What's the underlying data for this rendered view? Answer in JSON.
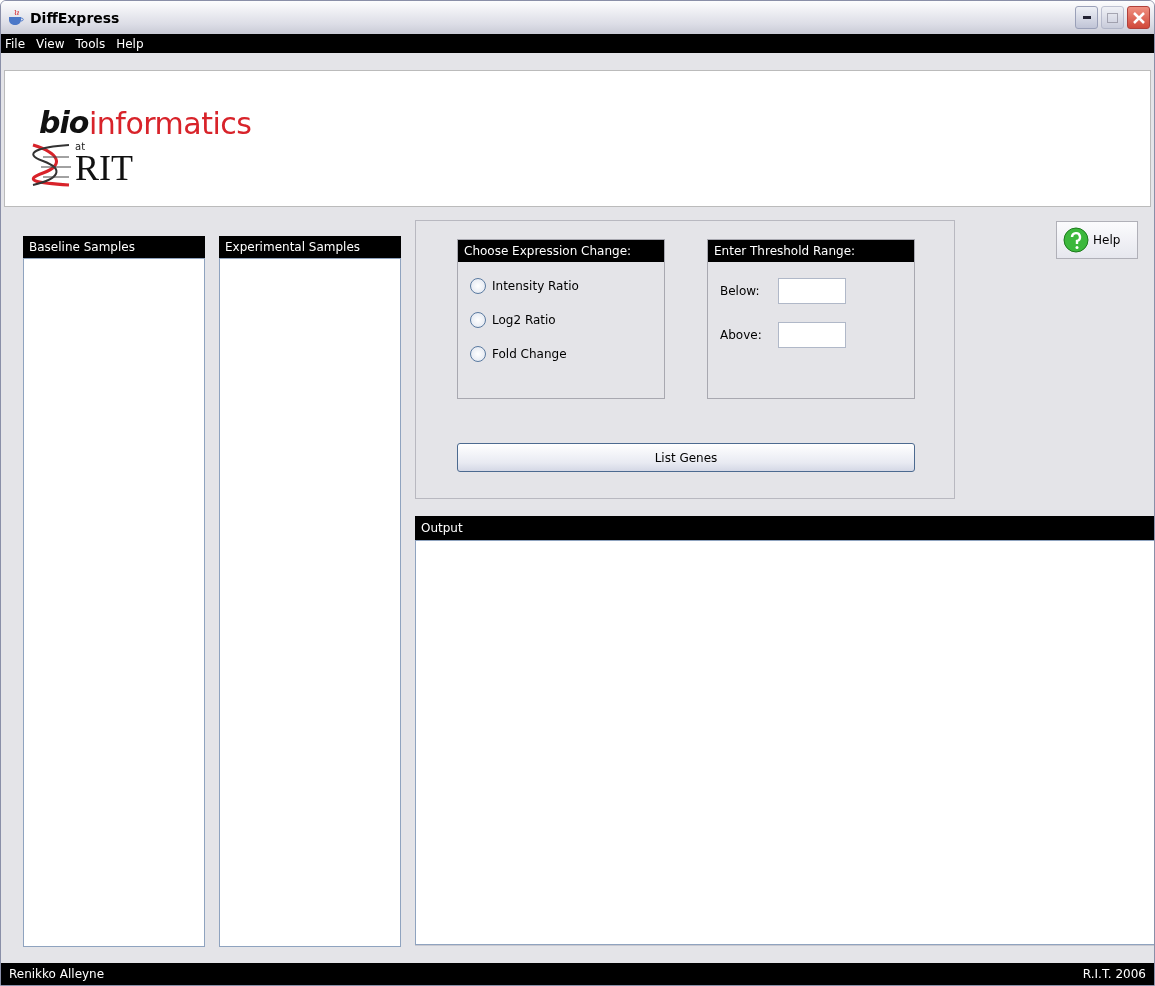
{
  "window": {
    "title": "DiffExpress"
  },
  "menu": [
    "File",
    "View",
    "Tools",
    "Help"
  ],
  "logo": {
    "prefix": "bio",
    "word": "informatics",
    "at": "at",
    "org": "RIT"
  },
  "lists": [
    {
      "title": "Baseline Samples"
    },
    {
      "title": "Experimental Samples"
    }
  ],
  "expression": {
    "title": "Choose Expression Change:",
    "options": [
      {
        "label": "Intensity Ratio",
        "selected": false
      },
      {
        "label": "Log2 Ratio",
        "selected": false
      },
      {
        "label": "Fold Change",
        "selected": false
      }
    ]
  },
  "threshold": {
    "title": "Enter Threshold Range:",
    "fields": [
      {
        "label": "Below:"
      },
      {
        "label": "Above:"
      }
    ]
  },
  "list_button": "List Genes",
  "help_button": "Help",
  "output": {
    "title": "Output"
  },
  "status_bar": {
    "left": "Renikko Alleyne",
    "right": "R.I.T. 2006"
  }
}
